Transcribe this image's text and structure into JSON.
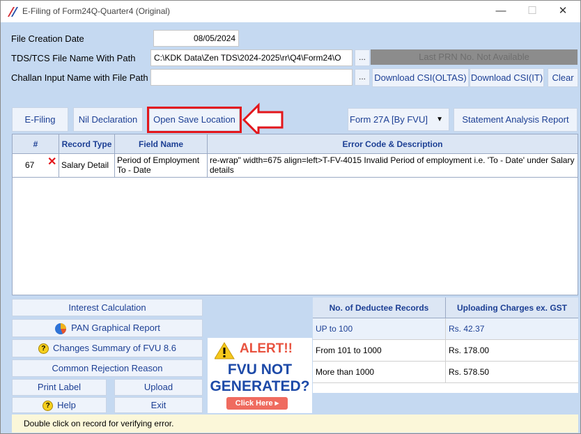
{
  "window": {
    "title": "E-Filing of Form24Q-Quarter4 (Original)"
  },
  "form": {
    "creation_date_label": "File Creation Date",
    "creation_date_value": "08/05/2024",
    "file_name_label": "TDS/TCS File Name With Path",
    "file_name_value": "C:\\KDK Data\\Zen TDS\\2024-2025\\rr\\Q4\\Form24\\O",
    "challan_label": "Challan Input Name with File Path",
    "challan_value": "",
    "browse_label": "...",
    "prn_text": "Last PRN No. Not Available"
  },
  "actions": {
    "download_oltas": "Download CSI(OLTAS)",
    "download_it": "Download CSI(IT)",
    "clear": "Clear",
    "efiling": "E-Filing",
    "nil_declaration": "Nil Declaration",
    "open_save_location": "Open Save Location",
    "form_select": "Form 27A [By FVU]",
    "statement_analysis": "Statement Analysis Report"
  },
  "grid": {
    "headers": [
      "#",
      "Record Type",
      "Field Name",
      "Error Code & Description"
    ],
    "rows": [
      {
        "num": "67",
        "record_type": "Salary Detail",
        "field_name": "Period of Employment To - Date",
        "description": "re-wrap\" width=675 align=left>T-FV-4015 Invalid Period of employment i.e. 'To - Date' under Salary details"
      }
    ]
  },
  "left_buttons": {
    "interest": "Interest Calculation",
    "pan_report": "PAN Graphical Report",
    "changes_summary": "Changes Summary of FVU 8.6",
    "common_rejection": "Common Rejection Reason",
    "print_label": "Print Label",
    "upload": "Upload",
    "help": "Help",
    "exit": "Exit"
  },
  "alert": {
    "title": "ALERT!!",
    "line1": "FVU NOT",
    "line2": "GENERATED?",
    "button": "Click Here ▸"
  },
  "charges": {
    "headers": [
      "No. of Deductee Records",
      "Uploading Charges ex. GST"
    ],
    "rows": [
      {
        "range": "UP to 100",
        "charge": "Rs. 42.37"
      },
      {
        "range": "From 101 to 1000",
        "charge": "Rs. 178.00"
      },
      {
        "range": "More than 1000",
        "charge": "Rs. 578.50"
      }
    ]
  },
  "status": {
    "text": "Double click on record for verifying error."
  },
  "colors": {
    "accent": "#1c3f94",
    "highlight": "#e3161b",
    "background": "#c5d9f1"
  }
}
